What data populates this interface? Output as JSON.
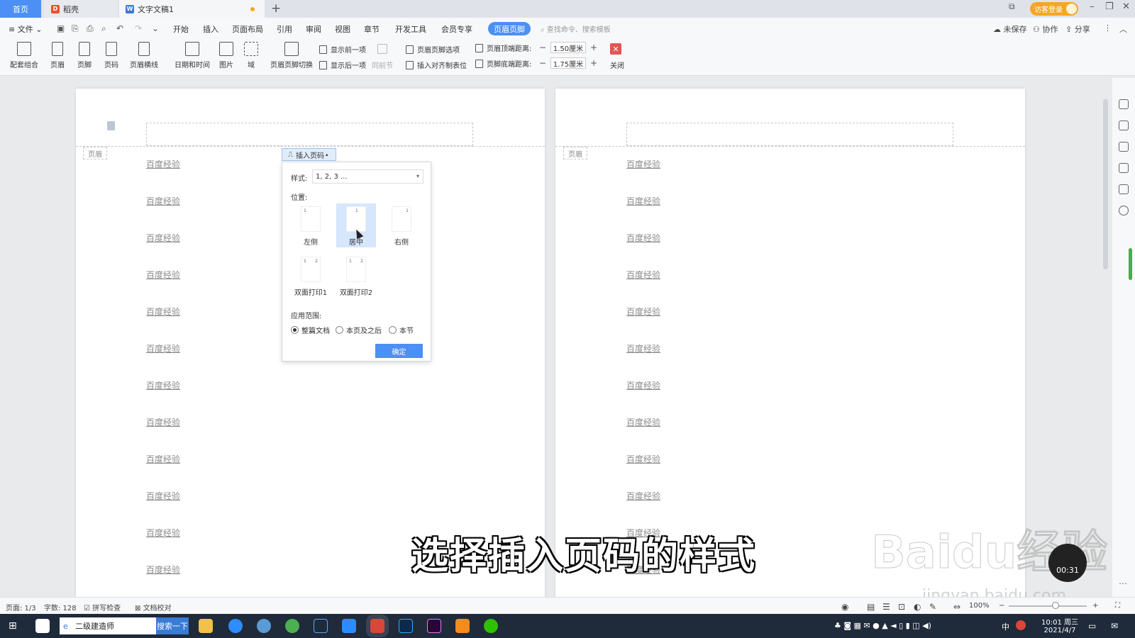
{
  "tabs": {
    "home": "首页",
    "daoke": "稻壳",
    "doc": "文字文稿1"
  },
  "titlebar": {
    "login": "访客登录"
  },
  "menu": {
    "file": "文件",
    "items": [
      "开始",
      "插入",
      "页面布局",
      "引用",
      "审阅",
      "视图",
      "章节",
      "开发工具",
      "会员专享"
    ],
    "active": "页眉页脚",
    "search_placeholder": "查找命令、搜索模板",
    "unsaved": "未保存",
    "collab": "协作",
    "share": "分享"
  },
  "ribbon": {
    "btn_combo": "配套组合",
    "btn_header": "页眉",
    "btn_footer": "页脚",
    "btn_pagenum": "页码",
    "btn_hline": "页眉横线",
    "btn_datetime": "日期和时间",
    "btn_image": "图片",
    "btn_field": "域",
    "btn_switch": "页眉页脚切换",
    "show_prev": "显示前一项",
    "show_next": "显示后一项",
    "same_prev": "同前节",
    "hf_options": "页眉页脚选项",
    "insert_align_tab": "插入对齐制表位",
    "header_top_label": "页眉顶端距离:",
    "header_top_value": "1.50厘米",
    "footer_bottom_label": "页脚底端距离:",
    "footer_bottom_value": "1.75厘米",
    "close": "关闭"
  },
  "document": {
    "header_tag": "页眉",
    "line_text": "百度经验",
    "page1_lines": [
      "百度经验",
      "百度经验",
      "百度经验",
      "百度经验",
      "百度经验",
      "百度经验",
      "百度经验",
      "百度经验",
      "百度经验",
      "百度经验",
      "百度经验",
      "百度经验"
    ],
    "page2_lines": [
      "百度经验",
      "百度经验",
      "百度经验",
      "百度经验",
      "百度经验",
      "百度经验",
      "百度经验",
      "百度经验",
      "百度经验",
      "百度经验",
      "百度经验",
      "百度经验"
    ]
  },
  "insert_page_number": {
    "button": "插入页码",
    "style_label": "样式:",
    "style_value": "1, 2, 3 ...",
    "position_label": "位置:",
    "positions": {
      "left": "左侧",
      "center": "居中",
      "right": "右侧",
      "duplex1": "双面打印1",
      "duplex2": "双面打印2"
    },
    "selected_position": "居中",
    "scope_label": "应用范围:",
    "scope_options": {
      "whole": "整篇文档",
      "after": "本页及之后",
      "section": "本节"
    },
    "selected_scope": "整篇文档",
    "ok": "确定"
  },
  "statusbar": {
    "page": "页面: 1/3",
    "words": "字数: 128",
    "spell": "拼写检查",
    "proof": "文档校对",
    "zoom": "100%"
  },
  "overlay": {
    "caption": "选择插入页码的样式",
    "watermark": "Baidu经验",
    "watermark_url": "jingyan.baidu.com",
    "timer": "00:31"
  },
  "taskbar": {
    "search_text": "二级建造师",
    "search_btn": "搜索一下",
    "time": "10:01 周三",
    "date": "2021/4/7",
    "ime": "中"
  }
}
